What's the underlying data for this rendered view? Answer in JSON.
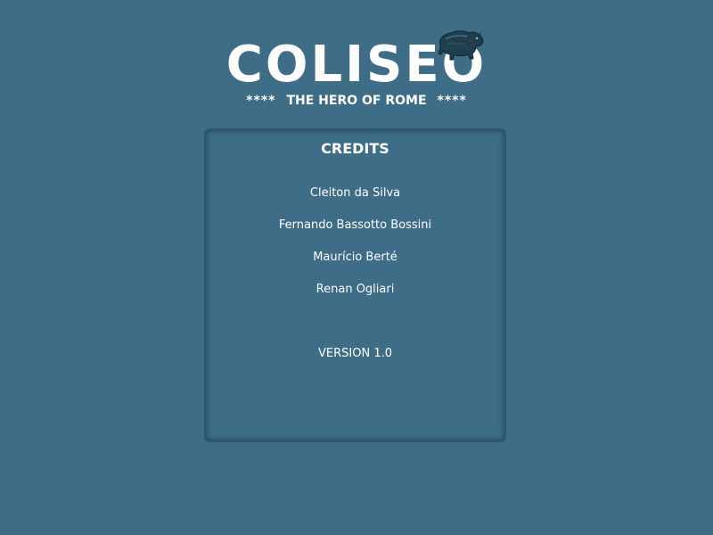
{
  "logo": {
    "title": "COLISEO",
    "subtitle_stars_left": "****",
    "subtitle": "THE HERO OF ROME",
    "subtitle_stars_right": "****",
    "emblem_icon": "bear-icon"
  },
  "credits": {
    "title": "CREDITS",
    "names": [
      "Cleiton da Silva",
      "Fernando Bassotto Bossini",
      "Maurício Berté",
      "Renan Ogliari"
    ],
    "version": "VERSION 1.0"
  },
  "colors": {
    "background": "#3e6d87",
    "panel_border": "#2f5a72",
    "text": "#ffffff"
  }
}
